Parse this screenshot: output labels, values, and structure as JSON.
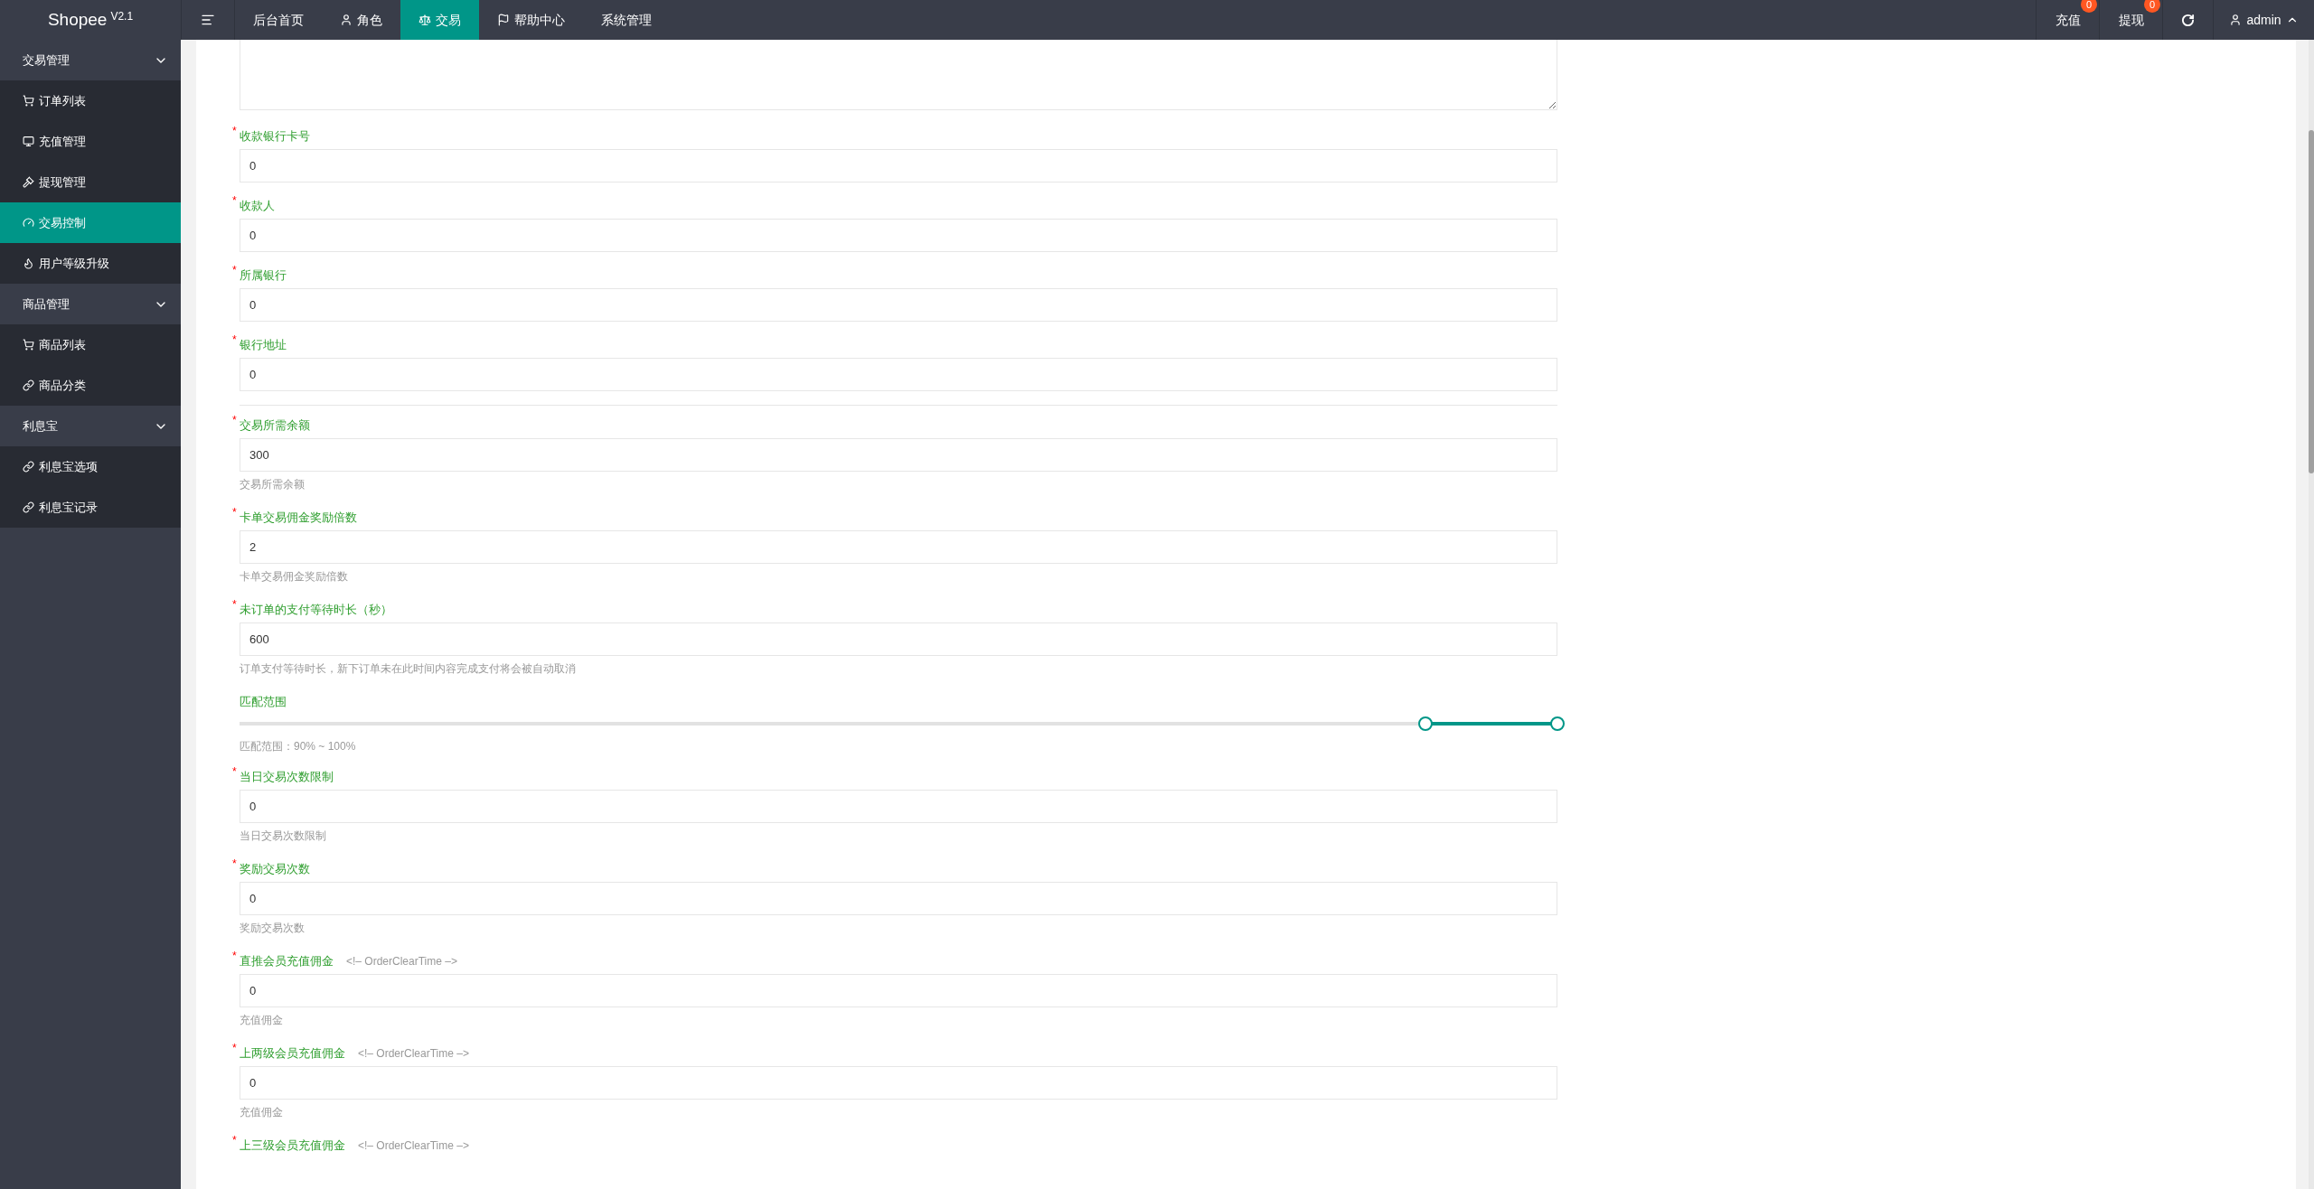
{
  "brand": {
    "name": "Shopee",
    "version": "V2.1"
  },
  "topnav": [
    {
      "label": "后台首页",
      "selected": false
    },
    {
      "label": "角色",
      "selected": false
    },
    {
      "label": "交易",
      "selected": true
    },
    {
      "label": "帮助中心",
      "selected": false
    },
    {
      "label": "系统管理",
      "selected": false
    }
  ],
  "toolbar": [
    {
      "label": "充值",
      "badge": "0"
    },
    {
      "label": "提现",
      "badge": "0"
    }
  ],
  "user": {
    "name": "admin"
  },
  "sidebar": [
    {
      "label": "交易管理",
      "expanded": true,
      "children": [
        {
          "label": "订单列表",
          "selected": false
        },
        {
          "label": "充值管理",
          "selected": false
        },
        {
          "label": "提现管理",
          "selected": false
        },
        {
          "label": "交易控制",
          "selected": true
        },
        {
          "label": "用户等级升级",
          "selected": false
        }
      ]
    },
    {
      "label": "商品管理",
      "expanded": true,
      "children": [
        {
          "label": "商品列表",
          "selected": false
        },
        {
          "label": "商品分类",
          "selected": false
        }
      ]
    },
    {
      "label": "利息宝",
      "expanded": true,
      "children": [
        {
          "label": "利息宝选项",
          "selected": false
        },
        {
          "label": "利息宝记录",
          "selected": false
        }
      ]
    }
  ],
  "form": [
    {
      "kind": "textarea"
    },
    {
      "kind": "input",
      "label": "收款银行卡号",
      "required": true,
      "mark": "*",
      "value": "0"
    },
    {
      "kind": "input",
      "label": "收款人",
      "required": true,
      "mark": "*",
      "value": "0"
    },
    {
      "kind": "input",
      "label": "所属银行",
      "required": true,
      "mark": "*",
      "value": "0"
    },
    {
      "kind": "input",
      "label": "银行地址",
      "required": true,
      "mark": "*",
      "value": "0"
    },
    {
      "kind": "divider"
    },
    {
      "kind": "input",
      "label": "交易所需余额",
      "required": true,
      "mark": "*",
      "value": "300",
      "help": "交易所需余额"
    },
    {
      "kind": "input",
      "label": "卡单交易佣金奖励倍数",
      "required": true,
      "mark": "*",
      "value": "2",
      "help": "卡单交易佣金奖励倍数"
    },
    {
      "kind": "input",
      "label": "未订单的支付等待时长（秒）",
      "required": true,
      "mark": "*",
      "value": "600",
      "help": "订单支付等待时长，新下订单未在此时间内容完成支付将会被自动取消"
    },
    {
      "kind": "range",
      "label": "匹配范围",
      "required": false,
      "handles": [
        {
          "level": 0.9
        },
        {
          "level": 1
        }
      ],
      "help": "匹配范围：90% ~ 100%"
    },
    {
      "kind": "input",
      "label": "当日交易次数限制",
      "required": true,
      "mark": "*",
      "value": "0",
      "help": "当日交易次数限制"
    },
    {
      "kind": "input",
      "label": "奖励交易次数",
      "required": true,
      "mark": "*",
      "value": "0",
      "help": "奖励交易次数"
    },
    {
      "kind": "input",
      "label": "直推会员充值佣金",
      "required": true,
      "mark": "*",
      "note": "<!– OrderClearTime –>",
      "value": "0",
      "help": "充值佣金"
    },
    {
      "kind": "input",
      "label": "上两级会员充值佣金",
      "required": true,
      "mark": "*",
      "note": "<!– OrderClearTime –>",
      "value": "0",
      "help": "充值佣金"
    },
    {
      "kind": "input",
      "label": "上三级会员充值佣金",
      "required": true,
      "mark": "*",
      "note": "<!– OrderClearTime –>"
    }
  ]
}
